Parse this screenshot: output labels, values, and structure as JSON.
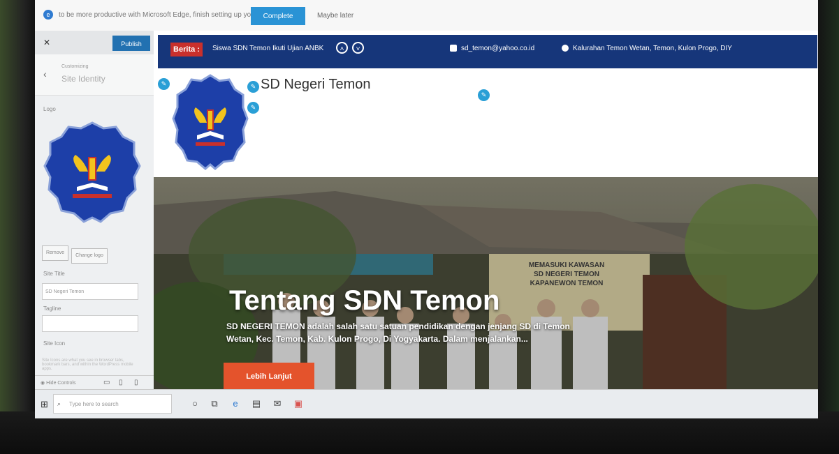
{
  "notification": {
    "message": "to be more productive with Microsoft Edge, finish setting up your browser",
    "cta": "Complete setup",
    "later": "Maybe later"
  },
  "customizer": {
    "close_icon": "close-icon",
    "publish": "Publish",
    "breadcrumb": "Customizing",
    "section_title": "Site Identity",
    "logo_label": "Logo",
    "remove_button": "Remove",
    "change_logo_button": "Change logo",
    "site_title_label": "Site Title",
    "site_title_value": "SD Negeri Temon",
    "tagline_label": "Tagline",
    "tagline_value": "",
    "site_icon_label": "Site Icon",
    "site_icon_desc": "Site Icons are what you see in browser tabs, bookmark bars, and within the WordPress mobile apps.",
    "hide_controls": "Hide Controls"
  },
  "site": {
    "berita_label": "Berita :",
    "ticker_text": "Siswa SDN Temon Ikuti Ujian ANBK",
    "email": "sd_temon@yahoo.co.id",
    "address": "Kalurahan Temon Wetan, Temon, Kulon Progo, DIY",
    "title": "SD Negeri Temon",
    "hero_title": "Tentang SDN Temon",
    "hero_text": "SD NEGERI TEMON adalah salah satu satuan pendidikan dengan jenjang SD di Temon Wetan, Kec. Temon, Kab. Kulon Progo, Di Yogyakarta. Dalam menjalankan...",
    "hero_button": "Lebih Lanjut",
    "banner_sign": [
      "MEMASUKI KAWASAN",
      "SD NEGERI TEMON",
      "KAPANEWON TEMON"
    ]
  },
  "taskbar": {
    "search_placeholder": "Type here to search"
  },
  "colors": {
    "topbar": "#16367a",
    "berita": "#c9302c",
    "hero_button": "#e4532c",
    "publish": "#2271b1",
    "cta": "#2a93d5"
  },
  "icons": [
    "edge-icon",
    "close-icon",
    "back-icon",
    "chevron-up-icon",
    "chevron-down-icon",
    "email-icon",
    "location-icon",
    "pencil-icon",
    "windows-icon",
    "search-icon",
    "task-view-icon",
    "desktop-icon",
    "tablet-icon",
    "mobile-icon"
  ]
}
